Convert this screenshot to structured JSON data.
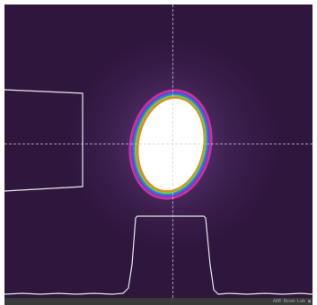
{
  "window": {
    "title": ""
  },
  "status_bar": {
    "text": "ADB·Beam·Lab ▣"
  },
  "colors": {
    "background_dark": "#2f163d",
    "background_glow": "#4c2c62",
    "crosshair": "#d2c8dc",
    "profile_line": "#e8e8ec",
    "beam_core": "#ffffff",
    "beam_ring_outer": "#d0309a",
    "beam_ring_mid": "#2a7fd6",
    "beam_ring_inner": "#e08a1a",
    "beam_ring_edge": "#7cc44a"
  }
}
